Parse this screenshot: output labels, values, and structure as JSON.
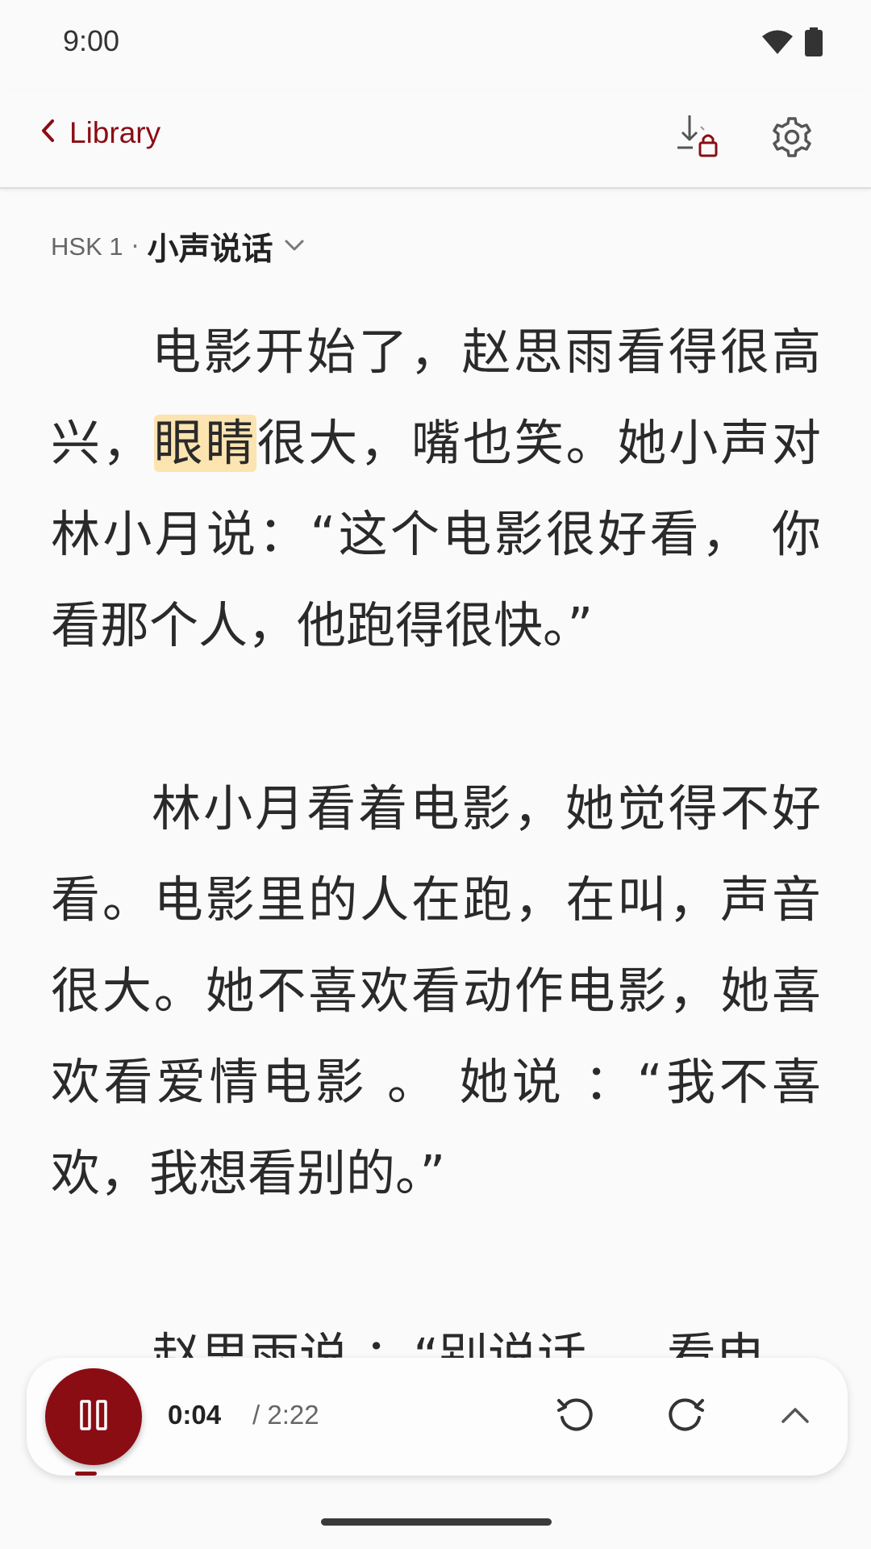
{
  "status_bar": {
    "time": "9:00",
    "icons": [
      "wifi-icon",
      "battery-icon"
    ]
  },
  "app_bar": {
    "back_label": "Library",
    "actions": [
      "download-locked-icon",
      "settings-gear-icon"
    ]
  },
  "breadcrumb": {
    "level": "HSK 1",
    "separator": "·",
    "title": "小声说话"
  },
  "reader": {
    "highlighted_word": "眼睛",
    "paragraphs": [
      {
        "before": "电影开始了，赵思雨看得很高兴，",
        "highlight": "眼睛",
        "after": "很大，嘴也笑。她小声对林小月说：“这个电影很好看， 你看那个人，他跑得很快。”"
      },
      {
        "before": "林小月看着电影，她觉得不好看。电影里的人在跑，在叫，声音很大。她不喜欢看动作电影，她喜欢看爱情电影 。 她说 ：“我不喜欢，我想看别的。”",
        "highlight": "",
        "after": ""
      },
      {
        "before": "赵思雨说 ：“别说话 ， 看电",
        "highlight": "",
        "after": ""
      }
    ]
  },
  "player": {
    "current_time": "0:04",
    "total_time": "/ 2:22",
    "progress": 0.028,
    "accent_color": "#8b0d14",
    "buttons": [
      "pause-icon",
      "rewind-icon",
      "forward-icon",
      "chevron-up-icon"
    ]
  }
}
